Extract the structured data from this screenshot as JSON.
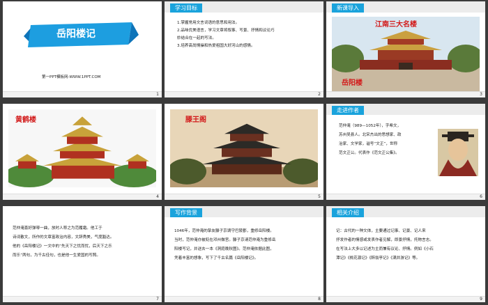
{
  "slides": [
    {
      "n": "1",
      "title": "岳阳楼记",
      "subtitle": "第一PPT模板网-WWW.1PPT.COM"
    },
    {
      "n": "2",
      "header": "学习目标",
      "lines": [
        "1.掌握常用文言词语的意思和用法。",
        "2.品味优美语言，学习文章将叙事、写景、抒情和议论巧",
        "妙结合在一起的写法。",
        "3.培养高尚情操和热爱祖国大好河山的感情。"
      ]
    },
    {
      "n": "3",
      "header": "新课导入",
      "caption_top": "江南三大名楼",
      "caption_bottom": "岳阳楼"
    },
    {
      "n": "4",
      "caption": "黄鹤楼"
    },
    {
      "n": "5",
      "caption": "滕王阁"
    },
    {
      "n": "6",
      "header": "走进作者",
      "lines": [
        "范仲淹（989—1052年），字希文，",
        "苏州吴县人。北宋杰出的思想家、政",
        "治家、文学家，谥号“文正”，世称",
        "范文正公。代表作《范文正公集》。"
      ]
    },
    {
      "n": "7",
      "lines": [
        "范仲淹喜好弹琴一曲，放时人称之为范履霜。他工于",
        "诗词散文，所作的文章富政治内容，文辞秀美，气度豁达。",
        "他的《岳阳楼记》一文中的“先天下之忧而忧，后天下之乐",
        "而乐”两句，为千古佳句，也是他一生爱国的写照。"
      ]
    },
    {
      "n": "8",
      "header": "写作背景",
      "lines": [
        "1046年，范仲淹的挚友滕子京谪守巴陵郡，重修岳阳楼。",
        "当时，范仲淹亦被贬在邓州做官。滕子京请范仲淹为重修岳",
        "阳楼写记，并送去一本《洞庭晚秋图》。范仲淹依据此图，",
        "凭着丰富的想象，写下了千古名篇《岳阳楼记》。"
      ]
    },
    {
      "n": "9",
      "header": "相关介绍",
      "lines": [
        "记：古代的一种文体，主要通过记事、记景、记人来",
        "抒发作者的情感或发表作者见解，即景抒情，托物言志。",
        "在写法上大多以记述为主而兼有议论、抒情。例如《小石",
        "潭记》《桃花源记》《醉翁亭记》《满井游记》等。"
      ]
    }
  ]
}
